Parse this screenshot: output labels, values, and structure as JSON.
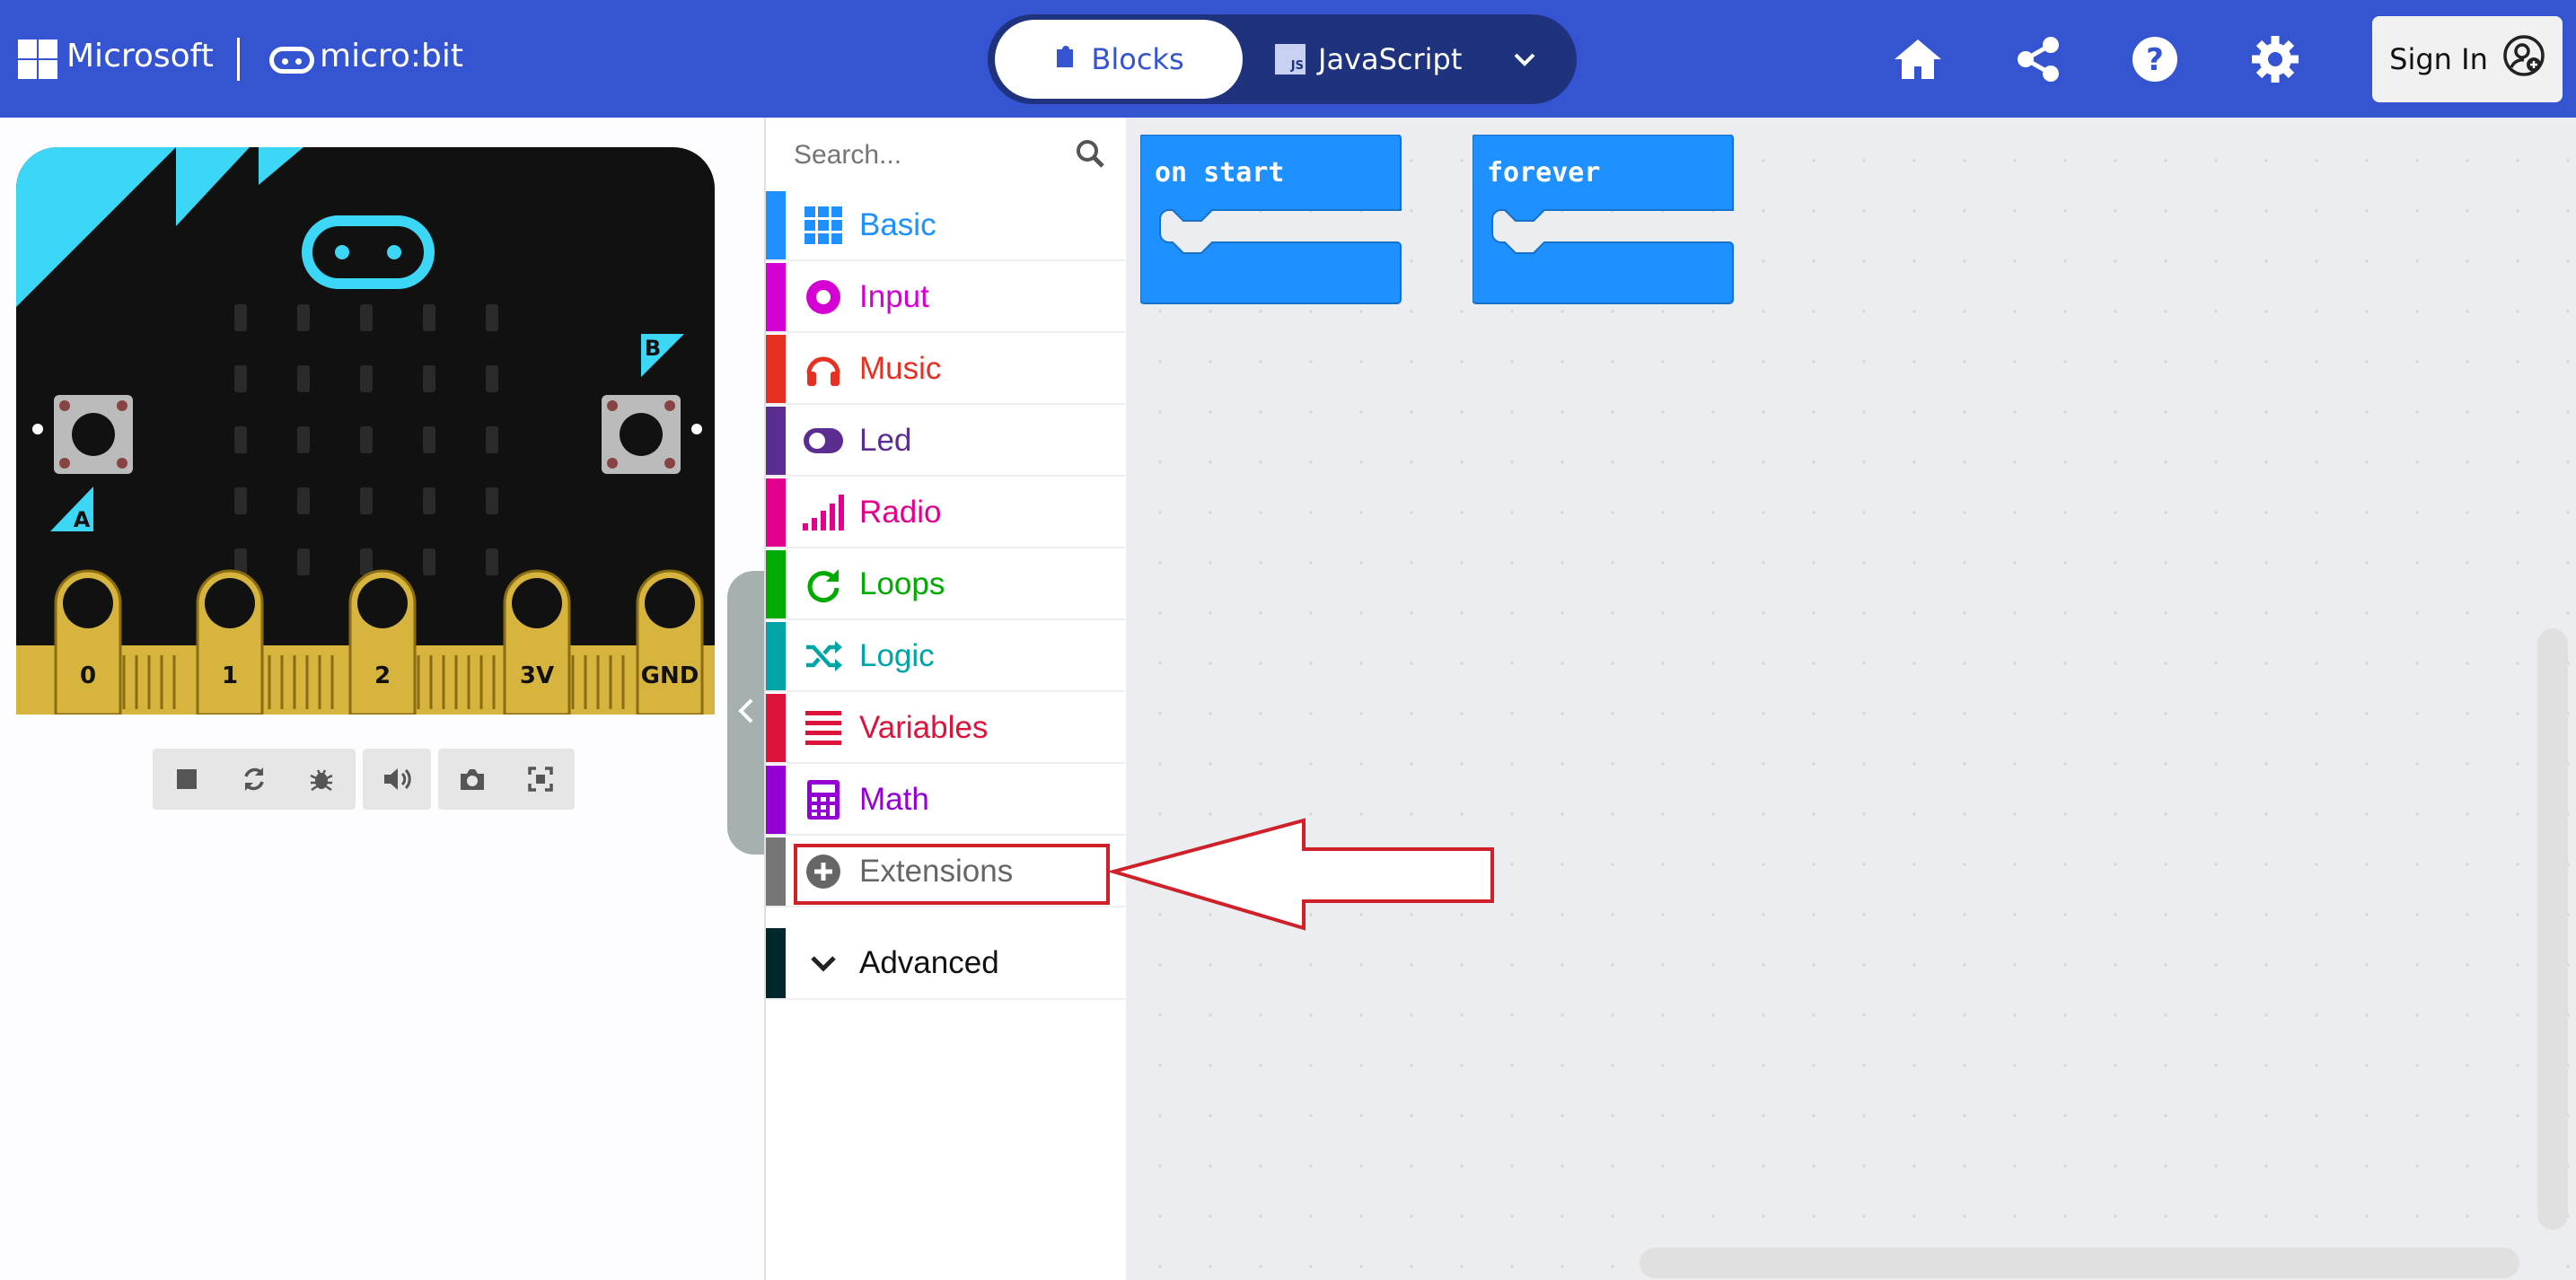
{
  "header": {
    "brand": "Microsoft",
    "product": "micro:bit",
    "tabs": {
      "blocks_label": "Blocks",
      "js_label": "JavaScript",
      "js_badge": "JS"
    },
    "signin_label": "Sign In",
    "icons": [
      "home-icon",
      "share-icon",
      "help-icon",
      "settings-icon"
    ],
    "bg_color": "#3454d1"
  },
  "simulator": {
    "pins": [
      "0",
      "1",
      "2",
      "3V",
      "GND"
    ],
    "buttons": {
      "a": "A",
      "b": "B"
    },
    "tools": [
      "stop-icon",
      "restart-icon",
      "debug-icon",
      "sound-icon",
      "screenshot-icon",
      "fullscreen-icon"
    ]
  },
  "toolbox": {
    "search_placeholder": "Search...",
    "categories": [
      {
        "label": "Basic",
        "color": "#1e90ff",
        "icon": "grid-icon"
      },
      {
        "label": "Input",
        "color": "#d400d4",
        "icon": "input-circle-icon"
      },
      {
        "label": "Music",
        "color": "#e63022",
        "icon": "headphones-icon"
      },
      {
        "label": "Led",
        "color": "#5c2d91",
        "icon": "toggle-icon"
      },
      {
        "label": "Radio",
        "color": "#e3008c",
        "icon": "signal-bars-icon"
      },
      {
        "label": "Loops",
        "color": "#00aa00",
        "icon": "loop-arrow-icon"
      },
      {
        "label": "Logic",
        "color": "#00a4a6",
        "icon": "shuffle-icon"
      },
      {
        "label": "Variables",
        "color": "#dc143c",
        "icon": "lines-icon"
      },
      {
        "label": "Math",
        "color": "#9400d3",
        "icon": "calculator-icon"
      },
      {
        "label": "Extensions",
        "color": "#777777",
        "icon": "plus-circle-icon"
      }
    ],
    "advanced_label": "Advanced",
    "advanced_color": "#00272b"
  },
  "workspace": {
    "blocks": [
      {
        "label": "on start",
        "color": "#1e90ff"
      },
      {
        "label": "forever",
        "color": "#1e90ff"
      }
    ],
    "annotation_color": "#d0202a"
  }
}
